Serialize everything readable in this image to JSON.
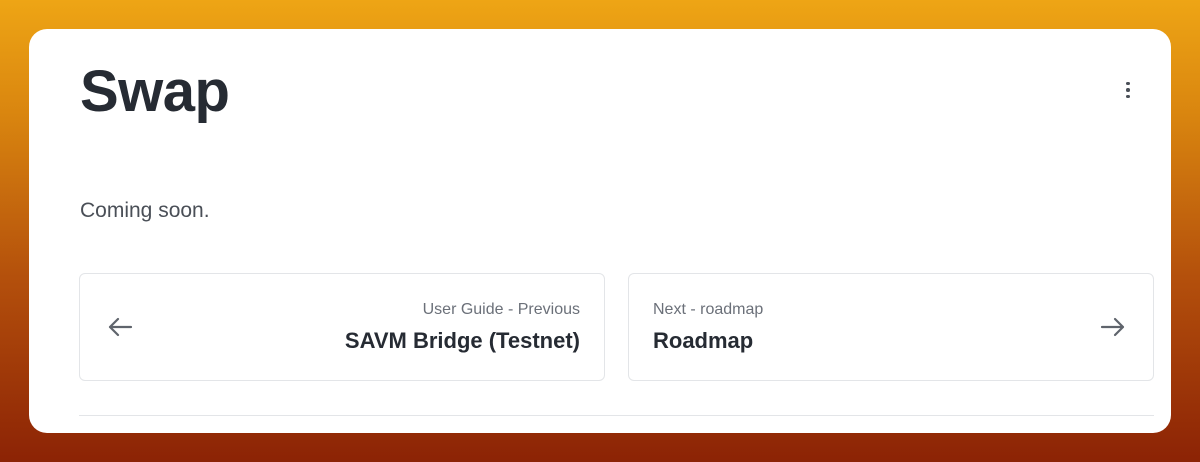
{
  "page": {
    "title": "Swap",
    "body_text": "Coming soon."
  },
  "menu": {
    "icon": "kebab-vertical-icon"
  },
  "pagination": {
    "previous": {
      "subtitle": "User Guide - Previous",
      "title": "SAVM Bridge (Testnet)",
      "icon": "arrow-left-icon"
    },
    "next": {
      "subtitle": "Next - roadmap",
      "title": "Roadmap",
      "icon": "arrow-right-icon"
    }
  },
  "colors": {
    "text_primary": "#262b33",
    "text_secondary": "#6b7079",
    "border": "#e3e5e8"
  }
}
